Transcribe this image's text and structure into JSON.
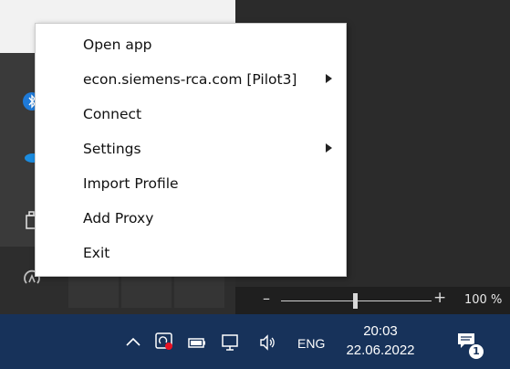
{
  "context_menu": {
    "items": [
      {
        "label": "Open app",
        "submenu": false
      },
      {
        "label": "econ.siemens-rca.com [Pilot3]",
        "submenu": true
      },
      {
        "label": "Connect",
        "submenu": false
      },
      {
        "label": "Settings",
        "submenu": true
      },
      {
        "label": "Import Profile",
        "submenu": false
      },
      {
        "label": "Add Proxy",
        "submenu": false
      },
      {
        "label": "Exit",
        "submenu": false
      }
    ]
  },
  "zoom": {
    "minus": "–",
    "plus": "+",
    "level": "100 %"
  },
  "taskbar": {
    "language": "ENG",
    "time": "20:03",
    "date": "22.06.2022",
    "notification_count": "1",
    "icons": [
      "chevron-up-icon",
      "vpn-client-icon",
      "battery-icon",
      "network-icon",
      "speaker-icon",
      "notification-icon"
    ]
  },
  "colors": {
    "taskbar": "#17325a",
    "menu_bg": "#ffffff",
    "vpn_status_dot": "#e81123"
  }
}
